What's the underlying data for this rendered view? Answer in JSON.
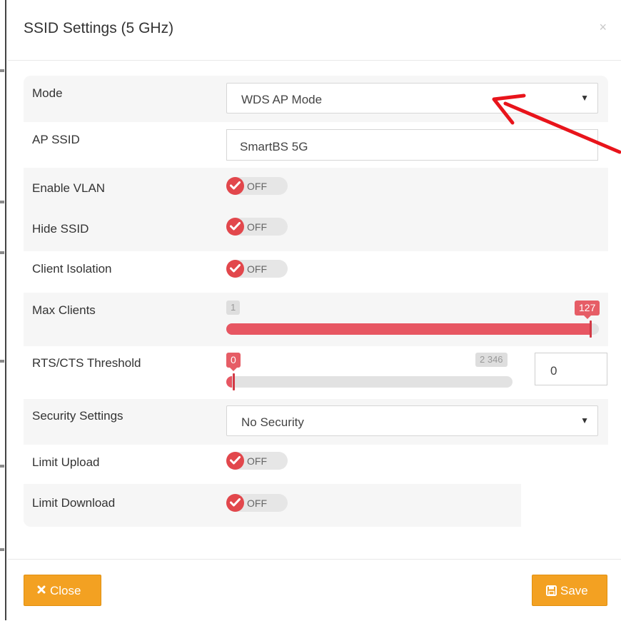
{
  "dialog": {
    "title": "SSID Settings (5 GHz)",
    "close_glyph": "×"
  },
  "fields": {
    "mode": {
      "label": "Mode",
      "value": "WDS AP Mode"
    },
    "ap_ssid": {
      "label": "AP SSID",
      "value": "SmartBS 5G"
    },
    "enable_vlan": {
      "label": "Enable VLAN",
      "state": "OFF"
    },
    "hide_ssid": {
      "label": "Hide SSID",
      "state": "OFF"
    },
    "client_isolation": {
      "label": "Client Isolation",
      "state": "OFF"
    },
    "max_clients": {
      "label": "Max Clients",
      "min": "1",
      "max": "127",
      "value": "127"
    },
    "rts_cts": {
      "label": "RTS/CTS Threshold",
      "min": "0",
      "max": "2 346",
      "value": "0",
      "input_value": "0"
    },
    "security": {
      "label": "Security Settings",
      "value": "No Security"
    },
    "limit_upload": {
      "label": "Limit Upload",
      "state": "OFF"
    },
    "limit_download": {
      "label": "Limit Download",
      "state": "OFF"
    }
  },
  "footer": {
    "close_label": "Close",
    "save_label": "Save"
  },
  "colors": {
    "accent": "#e75662",
    "button": "#f3a122",
    "annotation": "#e8141b"
  },
  "icons": {
    "toggle": "check-icon",
    "close": "close-icon",
    "save": "save-icon",
    "caret": "caret-down-icon"
  }
}
